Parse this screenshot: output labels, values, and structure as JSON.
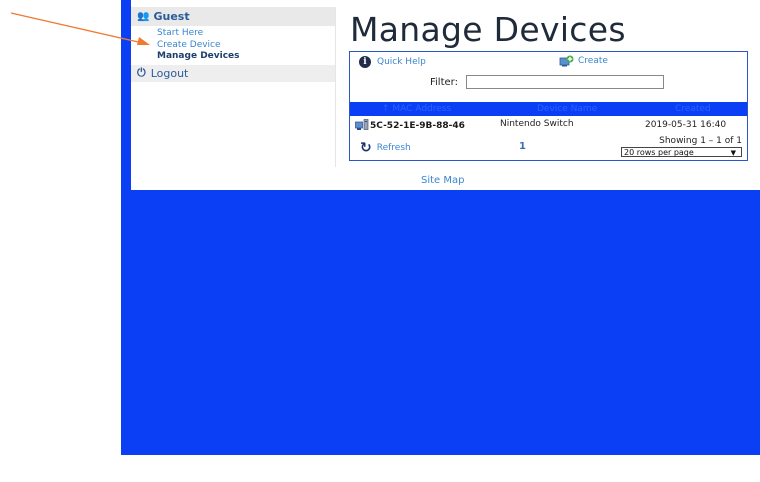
{
  "sidebar": {
    "group_label": "Guest",
    "items": [
      {
        "label": "Start Here"
      },
      {
        "label": "Create Device"
      },
      {
        "label": "Manage Devices"
      }
    ],
    "logout_label": "Logout"
  },
  "page_title": "Manage Devices",
  "toolbar": {
    "quick_help_label": "Quick Help",
    "create_label": "Create"
  },
  "filter": {
    "label": "Filter:",
    "value": "",
    "placeholder": ""
  },
  "table": {
    "columns": [
      "MAC Address",
      "Device Name",
      "Created"
    ],
    "sort_indicator": "↑",
    "rows": [
      {
        "mac": "5C-52-1E-9B-88-46",
        "device_name": "Nintendo Switch",
        "created": "2019-05-31 16:40"
      }
    ]
  },
  "pager": {
    "refresh_label": "Refresh",
    "current_page": "1",
    "showing": "Showing 1 – 1 of 1",
    "rows_per_page": "20 rows per page"
  },
  "footer": {
    "site_map_label": "Site Map"
  },
  "colors": {
    "page_background": "#0a3ff5",
    "link": "#3a86d1",
    "annotation_arrow": "#f07a2f"
  },
  "icons": {
    "group": "users-icon",
    "logout": "power-icon",
    "help": "info-icon",
    "create": "add-device-icon",
    "device": "network-device-icon",
    "refresh": "refresh-icon"
  }
}
